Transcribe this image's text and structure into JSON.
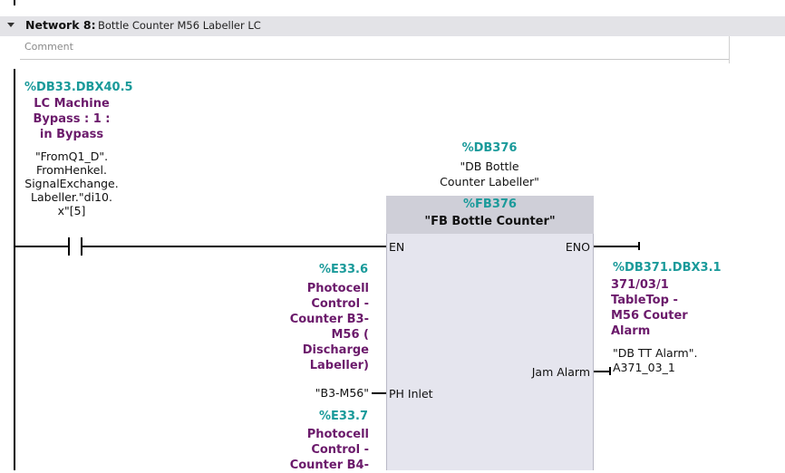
{
  "network": {
    "title": "Network 8:",
    "description": "Bottle Counter M56 Labeller  LC",
    "comment_placeholder": "Comment"
  },
  "contact": {
    "address": "%DB33.DBX40.5",
    "name_lines": [
      "LC Machine",
      "Bypass : 1 :",
      "in Bypass"
    ],
    "symbol_lines": [
      "\"FromQ1_D\".",
      "FromHenkel.",
      "SignalExchange.",
      "Labeller.\"di10.",
      "x\"[5]"
    ]
  },
  "instance": {
    "address": "%DB376",
    "symbol_lines": [
      "\"DB Bottle",
      "Counter Labeller\""
    ]
  },
  "block": {
    "address": "%FB376",
    "name": "\"FB Bottle Counter\"",
    "pins": {
      "en": "EN",
      "eno": "ENO",
      "ph_inlet": "PH Inlet",
      "jam_alarm": "Jam Alarm"
    }
  },
  "input_ph_inlet": {
    "address": "%E33.6",
    "name_lines": [
      "Photocell",
      "Control -",
      "Counter B3-",
      "M56 (",
      "Discharge",
      "Labeller)"
    ],
    "symbol": "\"B3-M56\""
  },
  "input_next": {
    "address": "%E33.7",
    "name_lines": [
      "Photocell",
      "Control -",
      "Counter B4-"
    ]
  },
  "output_jam_alarm": {
    "address": "%DB371.DBX3.1",
    "name_lines": [
      "371/03/1",
      "TableTop -",
      "M56 Couter",
      "Alarm"
    ],
    "symbol_lines": [
      "\"DB TT Alarm\".",
      "A371_03_1"
    ]
  },
  "colors": {
    "address": "#1a9a9a",
    "tag_name": "#6b1a6b",
    "header_bg": "#e3e3e7",
    "block_bg": "#e5e5ee",
    "block_header_bg": "#cfcfd8"
  }
}
